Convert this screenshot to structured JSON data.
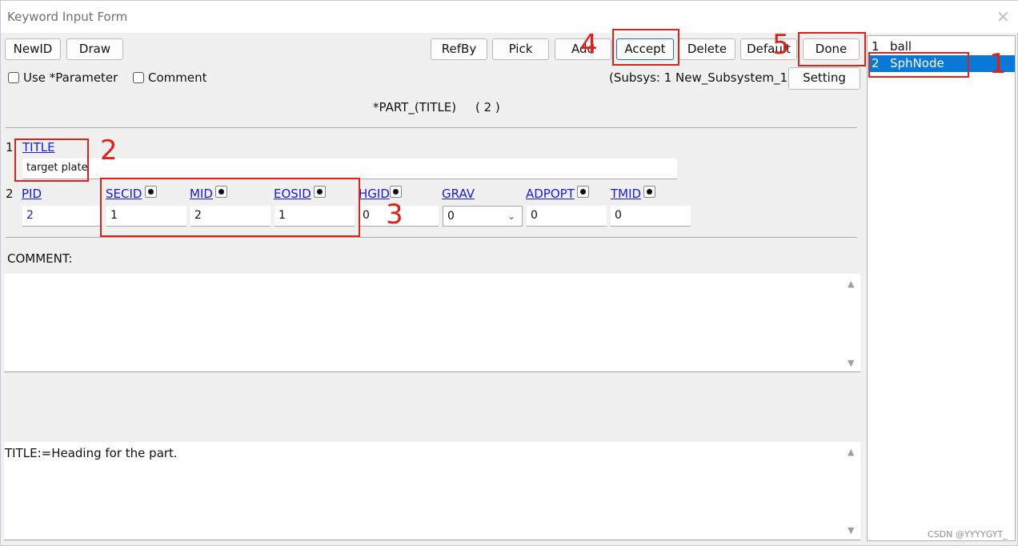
{
  "window": {
    "title": "Keyword Input Form",
    "close_glyph": "✕"
  },
  "toolbar": {
    "newid": "NewID",
    "draw": "Draw",
    "refby": "RefBy",
    "pick": "Pick",
    "add": "Add",
    "accept": "Accept",
    "delete": "Delete",
    "default": "Default",
    "done": "Done"
  },
  "options": {
    "use_parameter": "Use *Parameter",
    "comment": "Comment",
    "subsys": "(Subsys: 1 New_Subsystem_1)",
    "setting": "Setting"
  },
  "keyword": {
    "heading": "*PART_(TITLE)     ( 2 )"
  },
  "row1": {
    "index": "1",
    "title_label": "TITLE",
    "title_value": "target plate"
  },
  "row2": {
    "index": "2",
    "labels": [
      "PID",
      "SECID",
      "MID",
      "EOSID",
      "HGID",
      "GRAV",
      "ADPOPT",
      "TMID"
    ],
    "values": [
      "2",
      "1",
      "2",
      "1",
      "0",
      "0",
      "0",
      "0"
    ]
  },
  "comment": {
    "label": "COMMENT:",
    "text": ""
  },
  "help": {
    "text": "TITLE:=Heading for the part."
  },
  "list": {
    "items": [
      {
        "index": "1",
        "name": "ball"
      },
      {
        "index": "2",
        "name": "SphNode"
      }
    ]
  },
  "annotations": [
    "1",
    "2",
    "3",
    "4",
    "5"
  ],
  "watermark": "CSDN @YYYYGYT_",
  "colors": {
    "accent": "#0a78d7",
    "annotation": "#e0201a",
    "link": "#1a1ad8"
  }
}
